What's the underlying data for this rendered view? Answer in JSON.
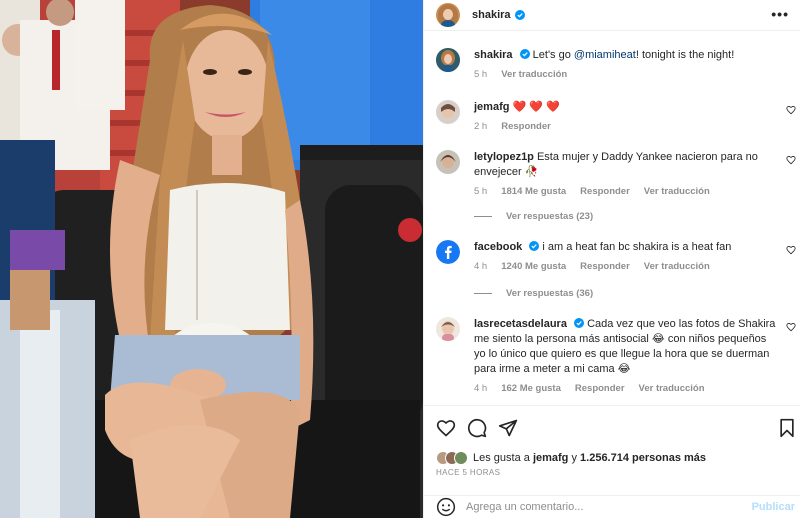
{
  "colors": {
    "link": "#00376b",
    "verified": "#0095f6",
    "heart": "#ed4956",
    "muted": "#8e8e8e",
    "publish": "#b2dffc",
    "facebook": "#1877f2"
  },
  "header": {
    "username": "shakira",
    "verified_icon": "verified-badge-icon",
    "more_icon": "more-options-icon",
    "more_glyph": "•••"
  },
  "caption": {
    "username": "shakira",
    "text_before": "Let's go ",
    "mention": "@miamiheat",
    "text_after": "! tonight is the night!",
    "time": "5 h",
    "translate": "Ver traducción"
  },
  "comments": [
    {
      "username": "jemafg",
      "text": "❤️ ❤️ ❤️",
      "time": "2 h",
      "likes": "",
      "reply": "Responder",
      "translate": ""
    },
    {
      "username": "letylopez1p",
      "text": "Esta mujer y Daddy Yankee nacieron para no envejecer 🥀",
      "time": "5 h",
      "likes": "1814 Me gusta",
      "reply": "Responder",
      "translate": "Ver traducción",
      "view_replies": "Ver respuestas (23)"
    },
    {
      "username": "facebook",
      "text": "i am a heat fan bc shakira is a heat fan",
      "time": "4 h",
      "likes": "1240 Me gusta",
      "reply": "Responder",
      "translate": "Ver traducción",
      "view_replies": "Ver respuestas (36)"
    },
    {
      "username": "lasrecetasdelaura",
      "text": "Cada vez que veo las fotos de Shakira me siento la persona más antisocial 😂 con niños pequeños yo lo único que quiero es que llegue la hora que se duerman para irme a meter a mi cama 😂",
      "time": "4 h",
      "likes": "162 Me gusta",
      "reply": "Responder",
      "translate": "Ver traducción"
    }
  ],
  "actions": {
    "like_icon": "heart-icon",
    "comment_icon": "comment-icon",
    "share_icon": "share-icon",
    "save_icon": "bookmark-icon"
  },
  "likes": {
    "prefix": "Les gusta a ",
    "user": "jemafg",
    "middle": " y ",
    "count": "1.256.714 personas más"
  },
  "timeago": "HACE 5 HORAS",
  "comment_box": {
    "placeholder": "Agrega un comentario...",
    "publish": "Publicar",
    "emoji_icon": "emoji-icon"
  }
}
